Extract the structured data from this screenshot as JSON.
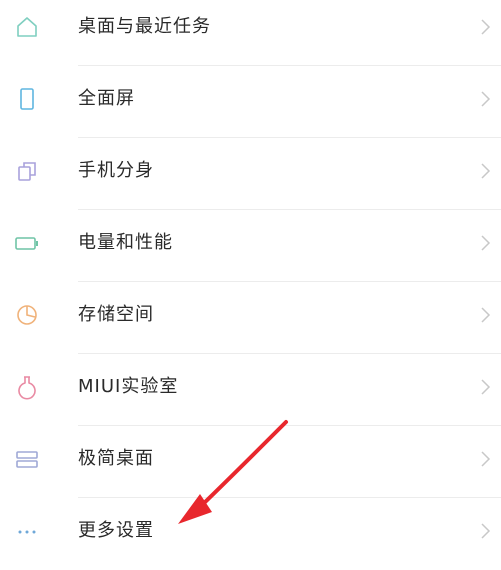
{
  "colors": {
    "home_icon": "#7fcfc0",
    "screen_icon": "#5fb6e0",
    "dual_apps_icon": "#a9a2dc",
    "battery_icon": "#6fc4a6",
    "storage_icon": "#f0b27a",
    "lab_icon": "#e98aa3",
    "simple_icon": "#9fa8d6",
    "more_icon": "#6fa8d8",
    "arrow": "#e8272d"
  },
  "items": [
    {
      "label": "桌面与最近任务",
      "icon": "home-icon"
    },
    {
      "label": "全面屏",
      "icon": "phone-screen-icon"
    },
    {
      "label": "手机分身",
      "icon": "dual-pages-icon"
    },
    {
      "label": "电量和性能",
      "icon": "battery-icon"
    },
    {
      "label": "存储空间",
      "icon": "pie-chart-icon"
    },
    {
      "label": "MIUI实验室",
      "icon": "lab-flask-icon"
    },
    {
      "label": "极简桌面",
      "icon": "simple-layout-icon"
    },
    {
      "label": "更多设置",
      "icon": "more-dots-icon"
    }
  ]
}
